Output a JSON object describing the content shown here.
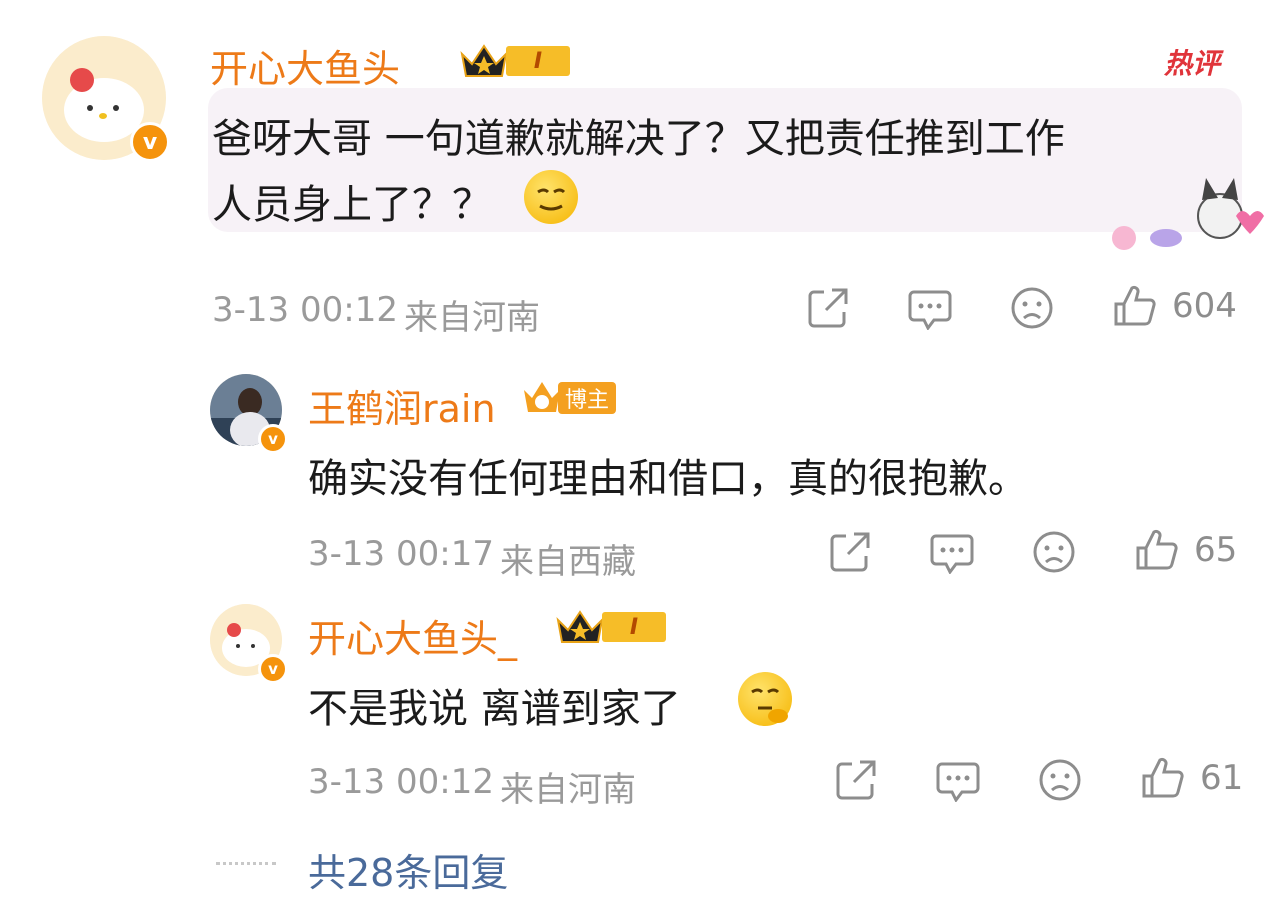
{
  "comments": [
    {
      "username": "开心大鱼头_",
      "level": "I",
      "hot_label": "热评",
      "text_line1": "爸呀大哥 一句道歉就解决了？又把责任推到工作",
      "text_line2": "人员身上了？？",
      "time": "3-13 00:12",
      "location": "来自河南",
      "likes": "604"
    },
    {
      "username": "王鹤润rain",
      "role_badge": "博主",
      "text": "确实没有任何理由和借口，真的很抱歉。",
      "time": "3-13 00:17",
      "location": "来自西藏",
      "likes": "65"
    },
    {
      "username": "开心大鱼头_",
      "level": "I",
      "text": "不是我说 离谱到家了",
      "time": "3-13 00:12",
      "location": "来自河南",
      "likes": "61"
    }
  ],
  "replies_link": "共28条回复",
  "colors": {
    "name": "#ed7a18",
    "meta": "#9a9a9a",
    "hot": "#e0343a",
    "link": "#4a6a9a"
  }
}
